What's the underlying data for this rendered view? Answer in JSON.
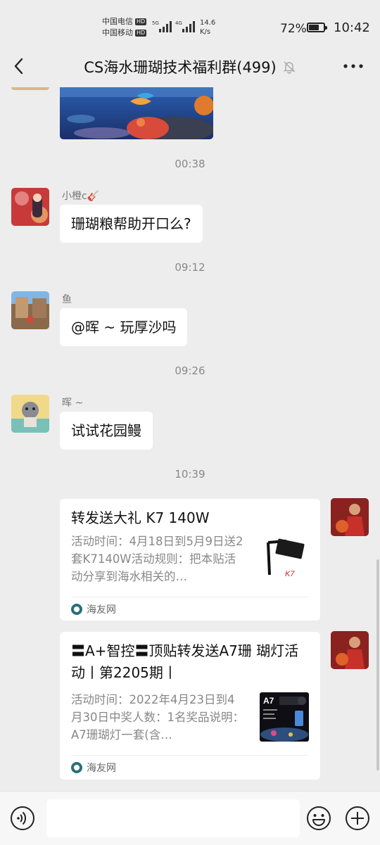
{
  "status_bar": {
    "carrier1": "中国电信",
    "carrier2": "中国移动",
    "hd": "HD",
    "net1": "5G",
    "net2": "4G",
    "speed_value": "14.6",
    "speed_unit": "K/s",
    "battery_percent": "72%",
    "battery_level": 0.72,
    "time": "10:42"
  },
  "header": {
    "title": "CS海水珊瑚技术福利群(499)"
  },
  "messages": {
    "t1": "00:38",
    "m1_sender": "小橙c🎸",
    "m1_text": "珊瑚粮帮助开口么?",
    "t2": "09:12",
    "m2_sender": "鱼",
    "m2_text": "@晖 ~  玩厚沙吗",
    "t3": "09:26",
    "m3_sender": "晖 ~",
    "m3_text": "试试花园鳗",
    "t4": "10:39",
    "card1": {
      "title": "转发送大礼 K7 140W",
      "desc": "活动时间：4月18日到5月9日送2套K7140W活动规则：把本贴活动分享到海水相关的…",
      "source": "海友网"
    },
    "card2": {
      "title": "〓A+智控〓顶贴转发送A7珊 瑚灯活动丨第2205期丨",
      "desc": "活动时间：2022年4月23日到4月30日中奖人数：1名奖品说明：A7珊瑚灯一套(含…",
      "source": "海友网",
      "thumb_label": "A7"
    }
  },
  "colors": {
    "chat_bg": "#ededed",
    "bubble": "#ffffff",
    "input_bar": "#f7f7f7"
  }
}
